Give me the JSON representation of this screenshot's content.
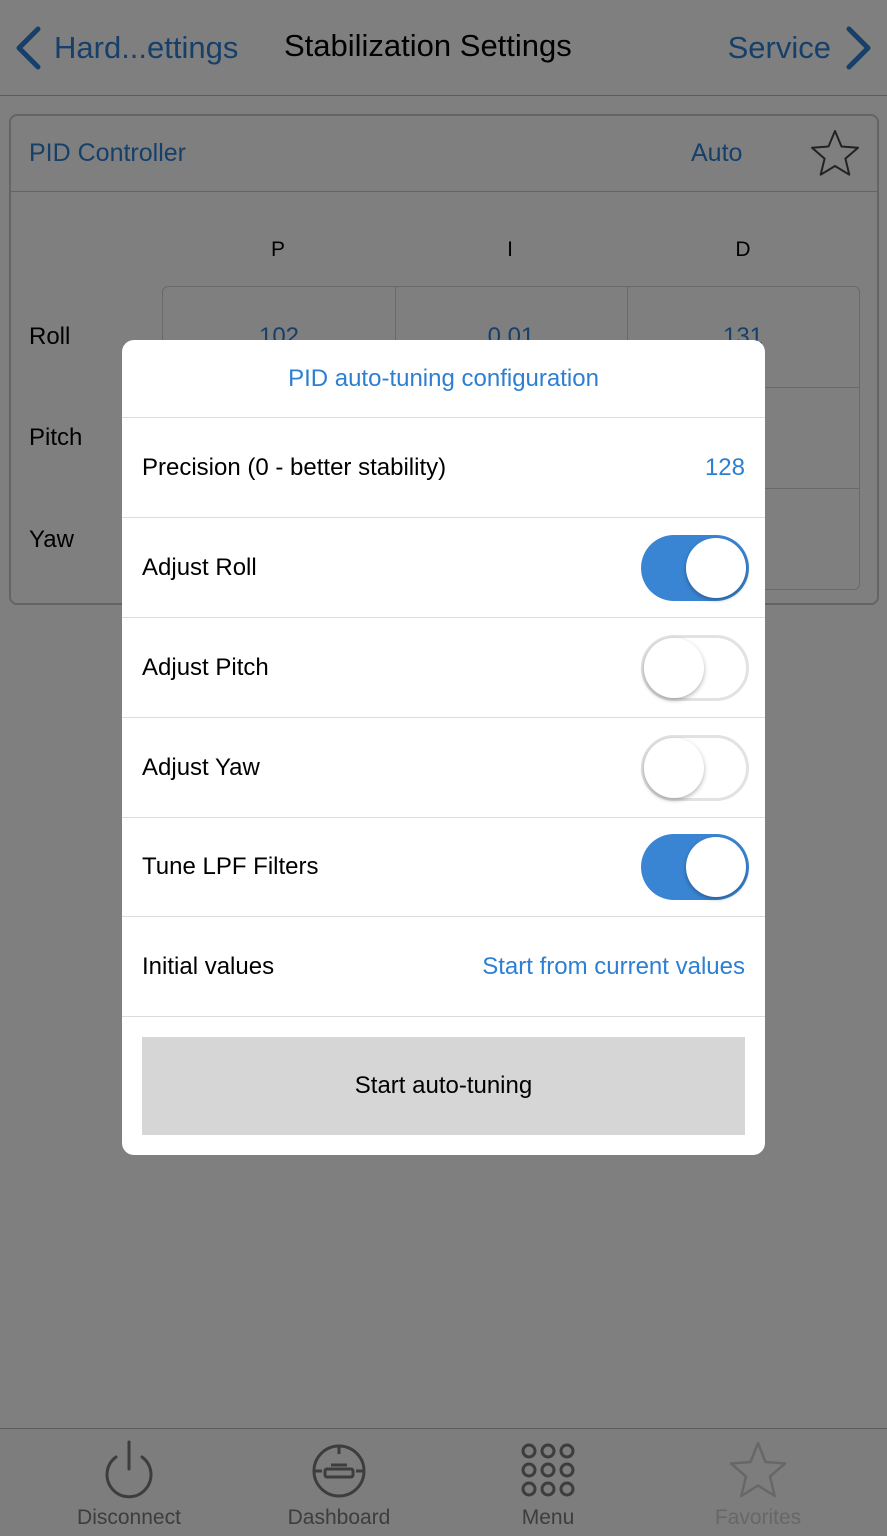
{
  "nav": {
    "back_label": "Hard...ettings",
    "title": "Stabilization Settings",
    "forward_label": "Service"
  },
  "card": {
    "title": "PID Controller",
    "mode": "Auto",
    "columns": [
      "P",
      "I",
      "D"
    ],
    "rows": [
      {
        "label": "Roll",
        "values": [
          "102",
          "0.01",
          "131"
        ]
      },
      {
        "label": "Pitch",
        "values": [
          "",
          "",
          ""
        ]
      },
      {
        "label": "Yaw",
        "values": [
          "",
          "",
          ""
        ]
      }
    ]
  },
  "dialog": {
    "title": "PID auto-tuning configuration",
    "precision": {
      "label": "Precision (0 - better stability)",
      "value": "128"
    },
    "toggles": [
      {
        "label": "Adjust Roll",
        "on": true
      },
      {
        "label": "Adjust Pitch",
        "on": false
      },
      {
        "label": "Adjust Yaw",
        "on": false
      },
      {
        "label": "Tune LPF Filters",
        "on": true
      }
    ],
    "initial_values": {
      "label": "Initial values",
      "value": "Start from current values"
    },
    "start_button": "Start auto-tuning"
  },
  "tabbar": {
    "tabs": [
      {
        "label": "Disconnect",
        "icon": "power-icon"
      },
      {
        "label": "Dashboard",
        "icon": "gauge-icon"
      },
      {
        "label": "Menu",
        "icon": "grid-dots-icon"
      },
      {
        "label": "Favorites",
        "icon": "star-icon",
        "disabled": true
      }
    ]
  },
  "colors": {
    "accent": "#2d7fd3",
    "toggle_on": "#3a85d3",
    "overlay": "rgba(0,0,0,0.5)",
    "button_bg": "#d6d6d6"
  }
}
